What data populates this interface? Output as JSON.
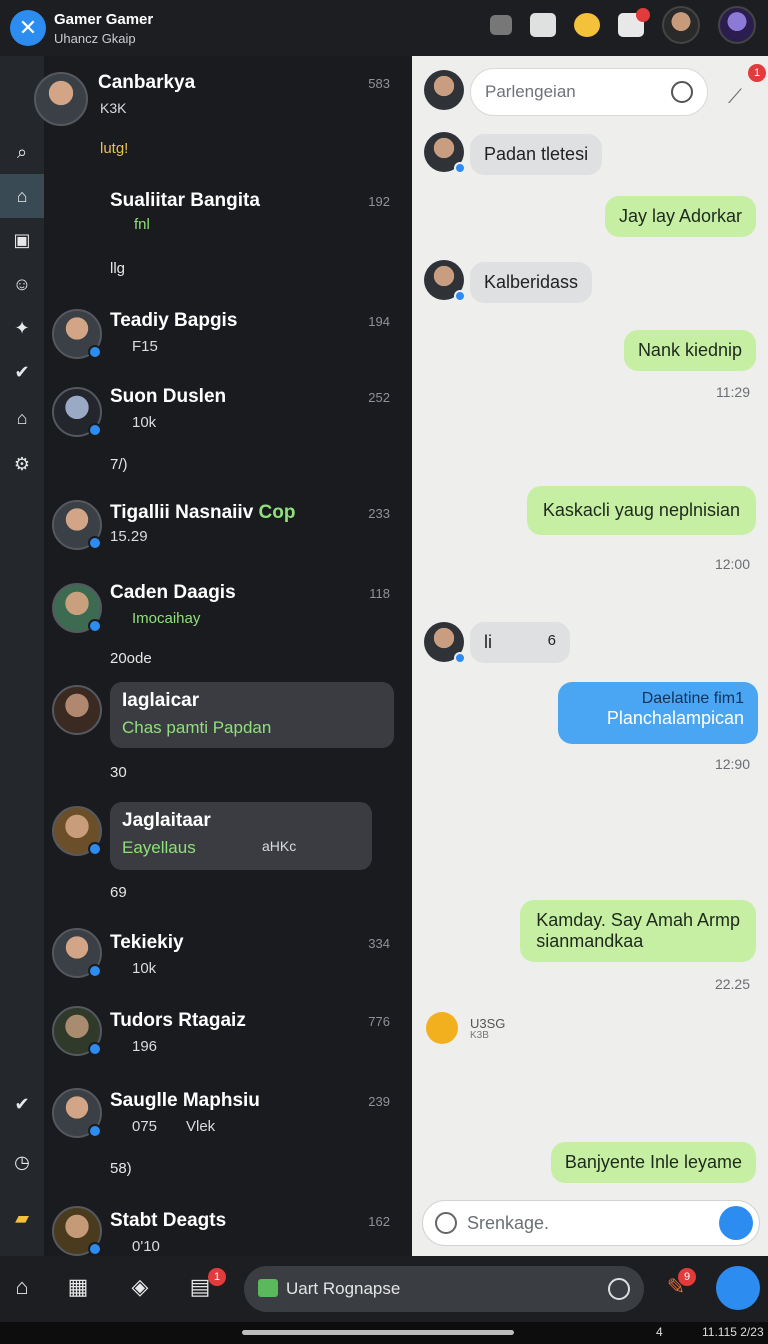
{
  "header": {
    "title": "Gamer Gamer",
    "subtitle": "Uhancz Gkaip"
  },
  "chats": [
    {
      "name": "Canbarkya",
      "meta": "K3K",
      "count": "583",
      "reactions": "lutg!"
    },
    {
      "name": "Sualiitar Bangita",
      "meta": "fnl",
      "count": "192",
      "reactions": "llg"
    },
    {
      "name": "Teadiy Bapgis",
      "meta": "F15",
      "count": "194"
    },
    {
      "name": "Suon Duslen",
      "meta": "10k",
      "count": "252",
      "reactions": "7/)"
    },
    {
      "name": "Tigallii Nasnaiiv",
      "name_suffix": "Cop",
      "meta": "15.29",
      "count": "233"
    },
    {
      "name": "Caden Daagis",
      "meta": "Imocaihay",
      "count": "118",
      "reactions": "20ode"
    },
    {
      "name": "Iaglaicar",
      "meta": "Chas pamti Papdan",
      "reactions": "30"
    },
    {
      "name": "Jaglaitaar",
      "meta": "Eayellaus",
      "meta2": "aHKc",
      "reactions": "69"
    },
    {
      "name": "Tekiekiy",
      "meta": "10k",
      "count": "334"
    },
    {
      "name": "Tudors Rtagaiz",
      "meta": "196",
      "count": "776"
    },
    {
      "name": "Sauglle Maphsiu",
      "meta": "075",
      "meta2": "Vlek",
      "count": "239",
      "reactions": "58)"
    },
    {
      "name": "Stabt Deagts",
      "meta": "0'10",
      "count": "162"
    }
  ],
  "conversation": {
    "search_placeholder": "Parlengeian",
    "badge": "1",
    "messages": [
      {
        "dir": "in",
        "text": "Padan tletesi"
      },
      {
        "dir": "out",
        "text": "Jay lay Adorkar"
      },
      {
        "dir": "in",
        "text": "Kalberidass"
      },
      {
        "dir": "out",
        "text": "Nank kiednip",
        "time": "11:29"
      },
      {
        "dir": "out",
        "text": "Kaskacli yaug neplnisian",
        "time": "12:00"
      },
      {
        "dir": "in",
        "text": "li",
        "extra": "6"
      },
      {
        "dir": "out-blue",
        "label": "Daelatine fim1",
        "text": "Planchalampican",
        "time": "12:90"
      },
      {
        "dir": "out",
        "text": "Kamday. Say Amah Armp",
        "text2": "sianmandkaa",
        "time": "22.25"
      },
      {
        "dir": "in-small",
        "text": "U3SG",
        "text2": "K3B"
      },
      {
        "dir": "out",
        "text": "Banjyente Inle leyame"
      }
    ],
    "compose_placeholder": "Srenkage."
  },
  "bottombar": {
    "search_text": "Uart Rognapse",
    "badge1": "1",
    "badge2": "9"
  },
  "statusbar": {
    "left": "4",
    "time": "11.115 2/23"
  },
  "colors": {
    "accent": "#2d8cf0",
    "out_bubble": "#c6efa3",
    "badge": "#e23b3b"
  }
}
